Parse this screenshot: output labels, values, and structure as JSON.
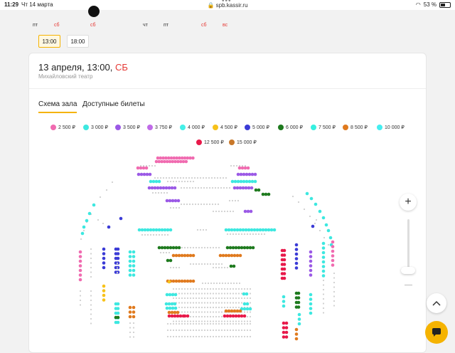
{
  "status": {
    "time": "11:29",
    "date": "Чт 14 марта",
    "url": "spb.kassir.ru",
    "battery": "53 %"
  },
  "dates": [
    {
      "wd": "пт",
      "red": false
    },
    {
      "wd": "сб",
      "red": true
    },
    {
      "wd": "сб",
      "red": true,
      "selected": true
    },
    {
      "wd": "чт",
      "red": false
    },
    {
      "wd": "пт",
      "red": false
    },
    {
      "wd": "сб",
      "red": true
    },
    {
      "wd": "вс",
      "red": true
    }
  ],
  "times": [
    {
      "label": "13:00",
      "active": true
    },
    {
      "label": "18:00",
      "active": false
    }
  ],
  "event": {
    "date_time": "13 апреля, 13:00,",
    "weekday": "СБ",
    "venue": "Михайловский театр"
  },
  "tabs": [
    {
      "label": "Схема зала",
      "active": true
    },
    {
      "label": "Доступные билеты",
      "active": false
    }
  ],
  "legend": [
    {
      "price": "2 500 ₽",
      "color": "#f06bb0"
    },
    {
      "price": "3 000 ₽",
      "color": "#3de8e0"
    },
    {
      "price": "3 500 ₽",
      "color": "#9b59e6"
    },
    {
      "price": "3 750 ₽",
      "color": "#c06be8"
    },
    {
      "price": "4 000 ₽",
      "color": "#44f0e8"
    },
    {
      "price": "4 500 ₽",
      "color": "#f7c21a"
    },
    {
      "price": "5 000 ₽",
      "color": "#3b3bd6"
    },
    {
      "price": "6 000 ₽",
      "color": "#1e7a1e"
    },
    {
      "price": "7 500 ₽",
      "color": "#36f0e0"
    },
    {
      "price": "8 500 ₽",
      "color": "#e07a1e"
    },
    {
      "price": "10 000 ₽",
      "color": "#44eef0"
    },
    {
      "price": "12 500 ₽",
      "color": "#e8194a"
    },
    {
      "price": "15 000 ₽",
      "color": "#c8782a"
    }
  ],
  "colors": {
    "accent": "#f5b301",
    "weekend": "#e53935"
  },
  "icons": {
    "zoom_in": "plus-icon",
    "zoom_out": "minus-icon",
    "scroll_up": "chevron-up-icon",
    "chat": "chat-icon"
  }
}
